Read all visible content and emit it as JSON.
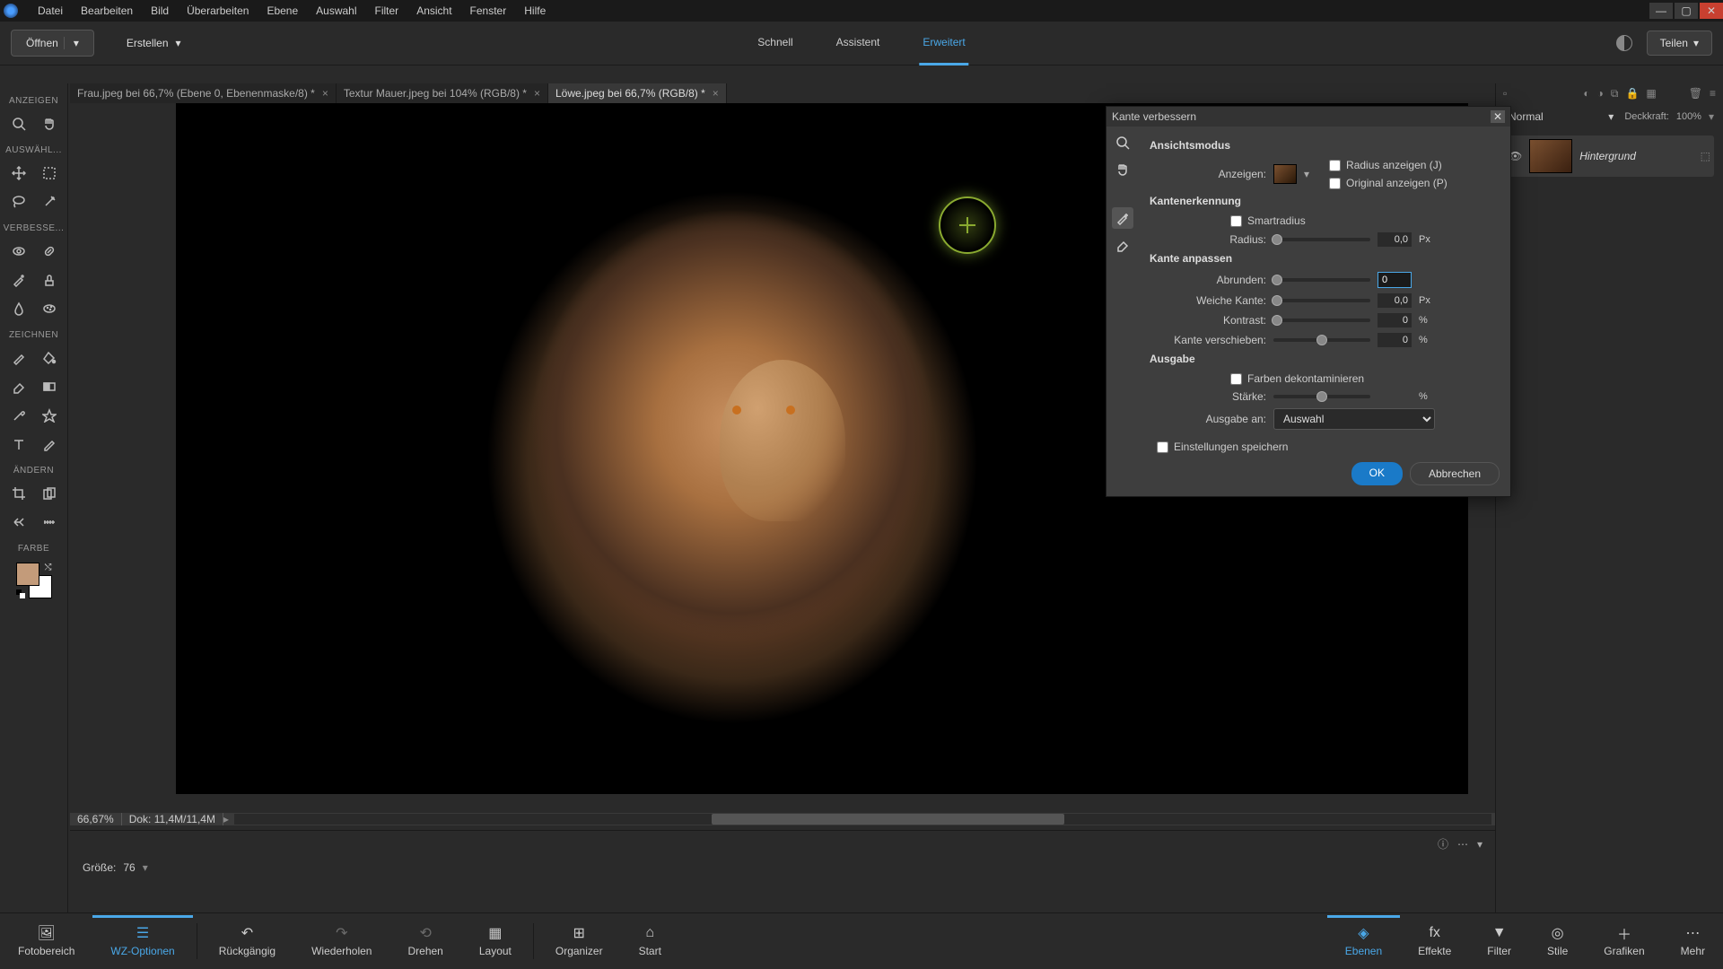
{
  "menu": [
    "Datei",
    "Bearbeiten",
    "Bild",
    "Überarbeiten",
    "Ebene",
    "Auswahl",
    "Filter",
    "Ansicht",
    "Fenster",
    "Hilfe"
  ],
  "secondbar": {
    "open": "Öffnen",
    "create": "Erstellen",
    "share": "Teilen"
  },
  "modes": {
    "quick": "Schnell",
    "guided": "Assistent",
    "expert": "Erweitert"
  },
  "toolsections": {
    "view": "ANZEIGEN",
    "select": "AUSWÄHL...",
    "enhance": "VERBESSE...",
    "draw": "ZEICHNEN",
    "modify": "ÄNDERN",
    "color": "FARBE"
  },
  "tabs": [
    {
      "label": "Frau.jpeg bei 66,7% (Ebene 0, Ebenenmaske/8) *"
    },
    {
      "label": "Textur Mauer.jpeg bei 104% (RGB/8) *"
    },
    {
      "label": "Löwe.jpeg bei 66,7% (RGB/8) *"
    }
  ],
  "status": {
    "zoom": "66,67%",
    "doc": "Dok: 11,4M/11,4M"
  },
  "toolopts": {
    "size_label": "Größe:",
    "size_value": "76"
  },
  "layers": {
    "blendmode": "Normal",
    "opacity_label": "Deckkraft:",
    "opacity": "100%",
    "layer0": "Hintergrund"
  },
  "dialog": {
    "title": "Kante verbessern",
    "sec_viewmode": "Ansichtsmodus",
    "show_label": "Anzeigen:",
    "chk_showradius": "Radius anzeigen (J)",
    "chk_showoriginal": "Original anzeigen (P)",
    "sec_edge": "Kantenerkennung",
    "chk_smart": "Smartradius",
    "radius_label": "Radius:",
    "radius_val": "0,0",
    "radius_unit": "Px",
    "sec_adjust": "Kante anpassen",
    "smooth_label": "Abrunden:",
    "smooth_val": "0",
    "feather_label": "Weiche Kante:",
    "feather_val": "0,0",
    "feather_unit": "Px",
    "contrast_label": "Kontrast:",
    "contrast_val": "0",
    "contrast_unit": "%",
    "shift_label": "Kante verschieben:",
    "shift_val": "0",
    "shift_unit": "%",
    "sec_output": "Ausgabe",
    "chk_decon": "Farben dekontaminieren",
    "amount_label": "Stärke:",
    "amount_unit": "%",
    "outto_label": "Ausgabe an:",
    "outto_value": "Auswahl",
    "chk_save": "Einstellungen speichern",
    "ok": "OK",
    "cancel": "Abbrechen"
  },
  "bottom": {
    "photobin": "Fotobereich",
    "tooloptions": "WZ-Optionen",
    "undo": "Rückgängig",
    "redo": "Wiederholen",
    "rotate": "Drehen",
    "layout": "Layout",
    "organizer": "Organizer",
    "home": "Start",
    "layers": "Ebenen",
    "effects": "Effekte",
    "filters": "Filter",
    "styles": "Stile",
    "graphics": "Grafiken",
    "more": "Mehr"
  }
}
